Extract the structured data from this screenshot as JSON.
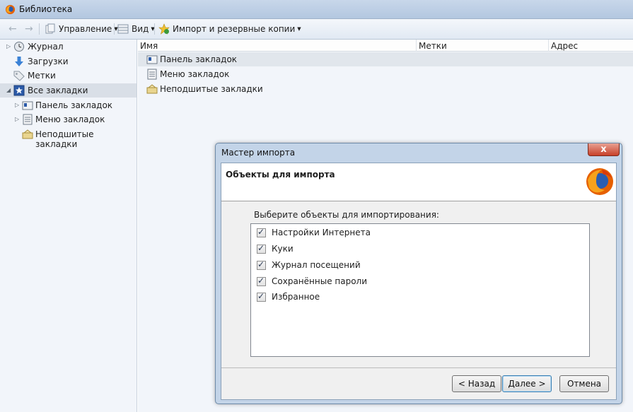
{
  "window": {
    "title": "Библиотека"
  },
  "toolbar": {
    "manage_label": "Управление",
    "view_label": "Вид",
    "import_label": "Импорт и резервные копии"
  },
  "sidebar": {
    "items": [
      {
        "label": "Журнал"
      },
      {
        "label": "Загрузки"
      },
      {
        "label": "Метки"
      },
      {
        "label": "Все закладки"
      },
      {
        "label": "Панель закладок"
      },
      {
        "label": "Меню закладок"
      },
      {
        "label": "Неподшитые закладки"
      }
    ]
  },
  "list": {
    "columns": [
      "Имя",
      "Метки",
      "Адрес"
    ],
    "rows": [
      {
        "name": "Панель закладок"
      },
      {
        "name": "Меню закладок"
      },
      {
        "name": "Неподшитые закладки"
      }
    ]
  },
  "dialog": {
    "title": "Мастер импорта",
    "heading": "Объекты для импорта",
    "prompt": "Выберите объекты для импортирования:",
    "items": [
      {
        "label": "Настройки Интернета",
        "checked": true
      },
      {
        "label": "Куки",
        "checked": true
      },
      {
        "label": "Журнал посещений",
        "checked": true
      },
      {
        "label": "Сохранённые пароли",
        "checked": true
      },
      {
        "label": "Избранное",
        "checked": true
      }
    ],
    "back_label": "< Назад",
    "next_label": "Далее >",
    "cancel_label": "Отмена",
    "close_glyph": "x"
  },
  "colors": {
    "titlebar": "#b9cbe2",
    "accent": "#3c7fb1",
    "close": "#c8412a"
  }
}
